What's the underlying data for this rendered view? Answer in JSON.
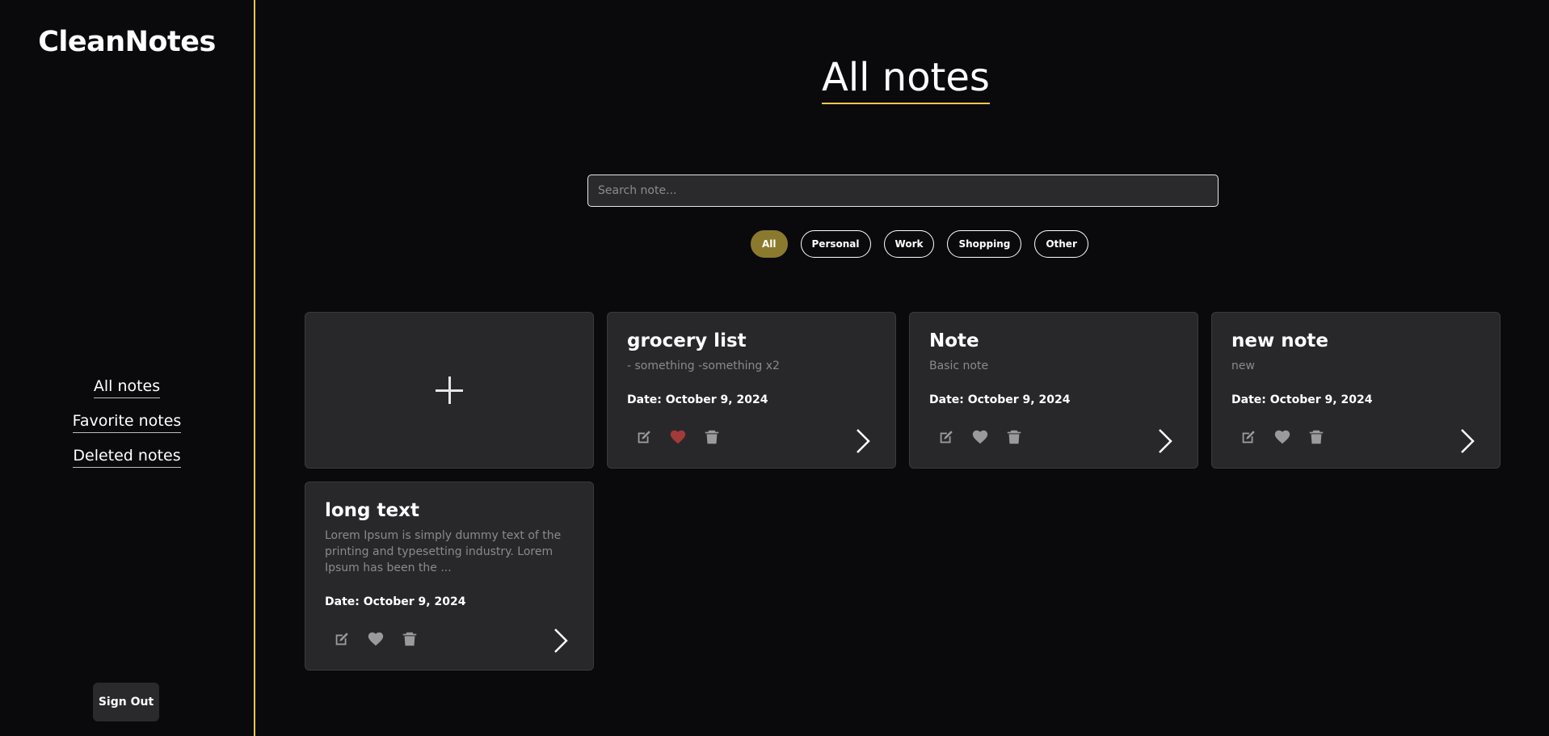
{
  "app": {
    "brand": "CleanNotes"
  },
  "sidebar": {
    "nav": [
      {
        "label": "All notes"
      },
      {
        "label": "Favorite notes"
      },
      {
        "label": "Deleted notes"
      }
    ],
    "signout_label": "Sign Out"
  },
  "main": {
    "title": "All notes",
    "search": {
      "placeholder": "Search note...",
      "value": ""
    },
    "filters": [
      {
        "label": "All",
        "active": true
      },
      {
        "label": "Personal",
        "active": false
      },
      {
        "label": "Work",
        "active": false
      },
      {
        "label": "Shopping",
        "active": false
      },
      {
        "label": "Other",
        "active": false
      }
    ],
    "notes": [
      {
        "title": "grocery list",
        "preview": "- something -something x2",
        "date": "Date: October 9, 2024",
        "favorite": true
      },
      {
        "title": "Note",
        "preview": "Basic note",
        "date": "Date: October 9, 2024",
        "favorite": false
      },
      {
        "title": "new note",
        "preview": "new",
        "date": "Date: October 9, 2024",
        "favorite": false
      },
      {
        "title": "long text",
        "preview": "Lorem Ipsum is simply dummy text of the printing and typesetting industry. Lorem Ipsum has been the ...",
        "date": "Date: October 9, 2024",
        "favorite": false
      }
    ]
  },
  "colors": {
    "accent": "#f1c84b",
    "active_chip": "#8b7a2e",
    "favorite": "#a33a3a",
    "icon": "#9a9a9d",
    "card_bg": "#28282b"
  },
  "icons": {
    "add": "plus-icon",
    "edit": "edit-icon",
    "favorite": "heart-icon",
    "delete": "trash-icon",
    "open": "chevron-right-icon"
  }
}
